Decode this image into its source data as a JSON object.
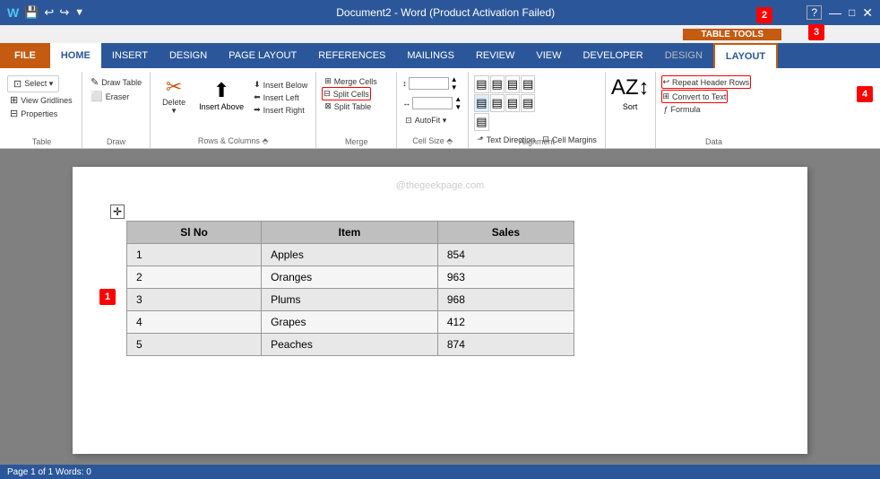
{
  "titleBar": {
    "title": "Document2 - Word (Product Activation Failed)",
    "saveIcon": "💾",
    "undoIcon": "↩",
    "redoIcon": "↪",
    "helpIcon": "?",
    "minIcon": "—",
    "maxIcon": "□",
    "closeIcon": "✕"
  },
  "tableToolsLabel": "TABLE TOOLS",
  "ribbonTabs": [
    {
      "id": "file",
      "label": "FILE",
      "type": "file"
    },
    {
      "id": "home",
      "label": "HOME",
      "type": "normal"
    },
    {
      "id": "insert",
      "label": "INSERT",
      "type": "normal"
    },
    {
      "id": "design",
      "label": "DESIGN",
      "type": "normal"
    },
    {
      "id": "pagelayout",
      "label": "PAGE LAYOUT",
      "type": "normal"
    },
    {
      "id": "references",
      "label": "REFERENCES",
      "type": "normal"
    },
    {
      "id": "mailings",
      "label": "MAILINGS",
      "type": "normal"
    },
    {
      "id": "review",
      "label": "REVIEW",
      "type": "normal"
    },
    {
      "id": "view",
      "label": "VIEW",
      "type": "normal"
    },
    {
      "id": "developer",
      "label": "DEVELOPER",
      "type": "normal"
    },
    {
      "id": "design2",
      "label": "DESIGN",
      "type": "tools"
    },
    {
      "id": "layout",
      "label": "LAYOUT",
      "type": "active-tools"
    }
  ],
  "ribbonGroups": {
    "table": {
      "label": "Table",
      "buttons": [
        {
          "id": "select",
          "label": "Select ▾",
          "icon": "⊞"
        },
        {
          "id": "viewgridlines",
          "label": "View Gridlines",
          "icon": "⊞"
        },
        {
          "id": "properties",
          "label": "Properties",
          "icon": "⊞"
        }
      ]
    },
    "draw": {
      "label": "Draw",
      "buttons": [
        {
          "id": "drawtable",
          "label": "Draw Table",
          "icon": "✏"
        },
        {
          "id": "eraser",
          "label": "Eraser",
          "icon": "◻"
        }
      ]
    },
    "deleteInsert": {
      "label": "",
      "deleteBtn": {
        "label": "Delete",
        "icon": "⊟"
      },
      "insertAbove": {
        "label": "Insert Above"
      },
      "insertBelow": {
        "label": "Insert Below"
      },
      "insertLeft": {
        "label": "Insert Left"
      },
      "insertRight": {
        "label": "Insert Right"
      }
    },
    "rowsColumns": {
      "label": "Rows & Columns"
    },
    "merge": {
      "label": "Merge",
      "buttons": [
        {
          "id": "mergecells",
          "label": "Merge Cells"
        },
        {
          "id": "splitcells",
          "label": "Split Cells"
        },
        {
          "id": "splittable",
          "label": "Split Table"
        }
      ]
    },
    "cellSize": {
      "label": "Cell Size",
      "autofit": "AutoFit"
    },
    "alignment": {
      "label": "Alignment",
      "textDirection": "Text Direction",
      "cellMargins": "Cell Margins"
    },
    "data": {
      "label": "Data",
      "sort": "Sort",
      "repeatHeaderRows": "Repeat Header Rows",
      "convertToText": "Convert to Text",
      "formula": "Formula"
    }
  },
  "watermark": "@thegeekpage.com",
  "table": {
    "headers": [
      "Sl No",
      "Item",
      "Sales"
    ],
    "rows": [
      [
        "1",
        "Apples",
        "854"
      ],
      [
        "2",
        "Oranges",
        "963"
      ],
      [
        "3",
        "Plums",
        "968"
      ],
      [
        "4",
        "Grapes",
        "412"
      ],
      [
        "5",
        "Peaches",
        "874"
      ]
    ]
  },
  "badges": {
    "b1": "1",
    "b2": "2",
    "b3": "3",
    "b4": "4"
  },
  "statusBar": {
    "text": "Page 1 of 1   Words: 0"
  }
}
